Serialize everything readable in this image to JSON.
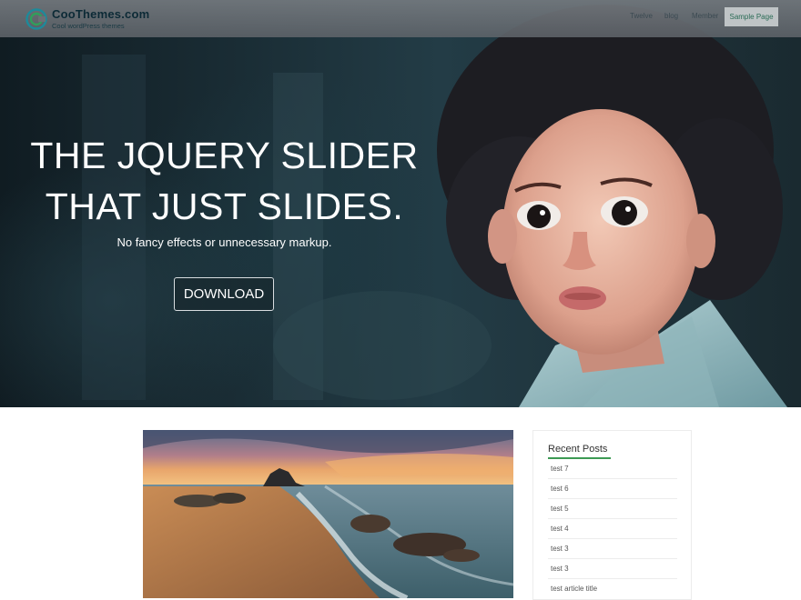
{
  "brand": {
    "title": "CooThemes.com",
    "tagline": "Cool wordPress themes"
  },
  "nav": {
    "items": [
      "Twelve",
      "blog",
      "Member"
    ],
    "active": "Sample Page"
  },
  "hero": {
    "title_line1": "THE JQUERY SLIDER",
    "title_line2": "THAT JUST SLIDES.",
    "subtitle": "No fancy effects or unnecessary markup.",
    "button": "DOWNLOAD"
  },
  "sidebar": {
    "widget_title": "Recent Posts",
    "posts": [
      "test 7",
      "test 6",
      "test 5",
      "test 4",
      "test 3",
      "test 3",
      "test article title"
    ]
  },
  "colors": {
    "accent": "#3d9a54",
    "nav_bg": "#6b7076",
    "active_nav": "#2a6b55"
  }
}
